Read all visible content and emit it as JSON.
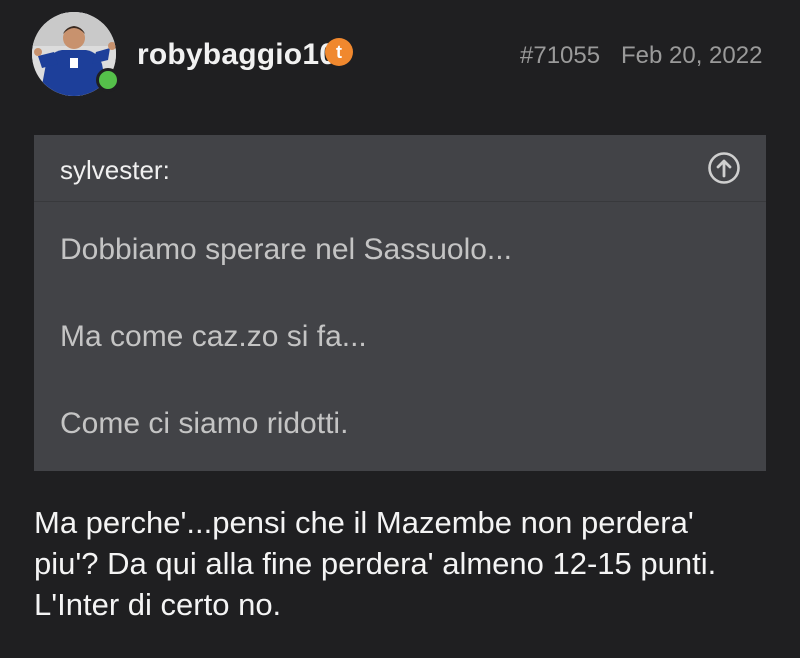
{
  "post": {
    "username": "robybaggio10",
    "badge_letter": "t",
    "post_number": "#71055",
    "date": "Feb 20, 2022",
    "colors": {
      "background": "#1f1f21",
      "quote_background": "#424347",
      "badge": "#f0882e",
      "online": "#55c04a"
    }
  },
  "quote": {
    "author": "sylvester:",
    "expand_icon": "arrow-up-circle-icon",
    "lines": [
      "Dobbiamo sperare nel Sassuolo...",
      "Ma come caz.zo si fa...",
      "Come ci siamo ridotti."
    ]
  },
  "reply": {
    "lines": [
      "Ma perche'...pensi che il Mazembe non perdera'",
      "piu'? Da qui alla fine perdera' almeno 12-15 punti.",
      "L'Inter di certo no."
    ]
  }
}
